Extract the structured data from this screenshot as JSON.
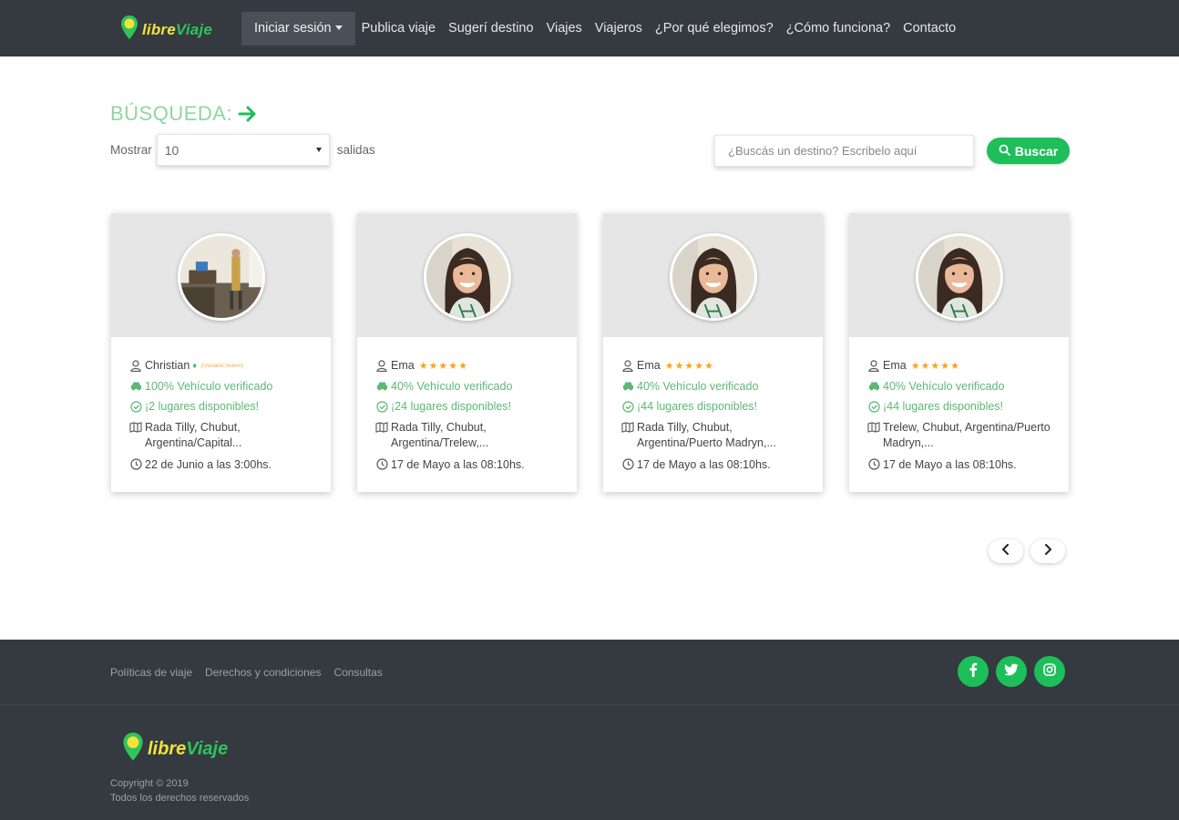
{
  "brand": {
    "part_a": "libre",
    "part_b": "Viaje"
  },
  "nav": {
    "login": "Iniciar sesión",
    "items": [
      "Publica viaje",
      "Sugerí destino",
      "Viajes",
      "Viajeros",
      "¿Por qué elegimos?",
      "¿Cómo funciona?",
      "Contacto"
    ]
  },
  "search": {
    "title": "BÚSQUEDA:",
    "show_label": "Mostrar",
    "show_value": "10",
    "show_suffix": "salidas",
    "placeholder": "¿Buscás un destino? Escribelo aquí",
    "button_label": "Buscar"
  },
  "cards": [
    {
      "name": "Christian",
      "stars": "",
      "tag": "(Usuario nuevo)",
      "vehicle": "100% Vehículo verificado",
      "seats": "¡2 lugares disponibles!",
      "route": "Rada Tilly, Chubut, Argentina/Capital...",
      "time": "22 de Junio a las 3:00hs.",
      "photo": "room"
    },
    {
      "name": "Ema",
      "stars": "★★★★★",
      "tag": "",
      "vehicle": "40% Vehículo verificado",
      "seats": "¡24 lugares disponibles!",
      "route": "Rada Tilly, Chubut, Argentina/Trelew,...",
      "time": "17 de Mayo a las 08:10hs.",
      "photo": "woman"
    },
    {
      "name": "Ema",
      "stars": "★★★★★",
      "tag": "",
      "vehicle": "40% Vehículo verificado",
      "seats": "¡44 lugares disponibles!",
      "route": "Rada Tilly, Chubut, Argentina/Puerto Madryn,...",
      "time": "17 de Mayo a las 08:10hs.",
      "photo": "woman"
    },
    {
      "name": "Ema",
      "stars": "★★★★★",
      "tag": "",
      "vehicle": "40% Vehículo verificado",
      "seats": "¡44 lugares disponibles!",
      "route": "Trelew, Chubut, Argentina/Puerto Madryn,...",
      "time": "17 de Mayo a las 08:10hs.",
      "photo": "woman"
    }
  ],
  "pagination": {
    "prev_icon": "chevron-left-icon",
    "next_icon": "chevron-right-icon"
  },
  "footer": {
    "links": [
      "Políticas de viaje",
      "Derechos y condiciones",
      "Consultas"
    ],
    "social": [
      "facebook-icon",
      "twitter-icon",
      "instagram-icon"
    ],
    "copyright_line1": "Copyright © 2019",
    "copyright_line2": "Todos los derechos reservados"
  },
  "colors": {
    "navbar": "#343a40",
    "accent_green": "#1ebe5a",
    "verified_green": "#5cb874",
    "title_green": "#8fd6a0",
    "star": "#f5a623",
    "logo_yellow": "#f2e33a"
  }
}
